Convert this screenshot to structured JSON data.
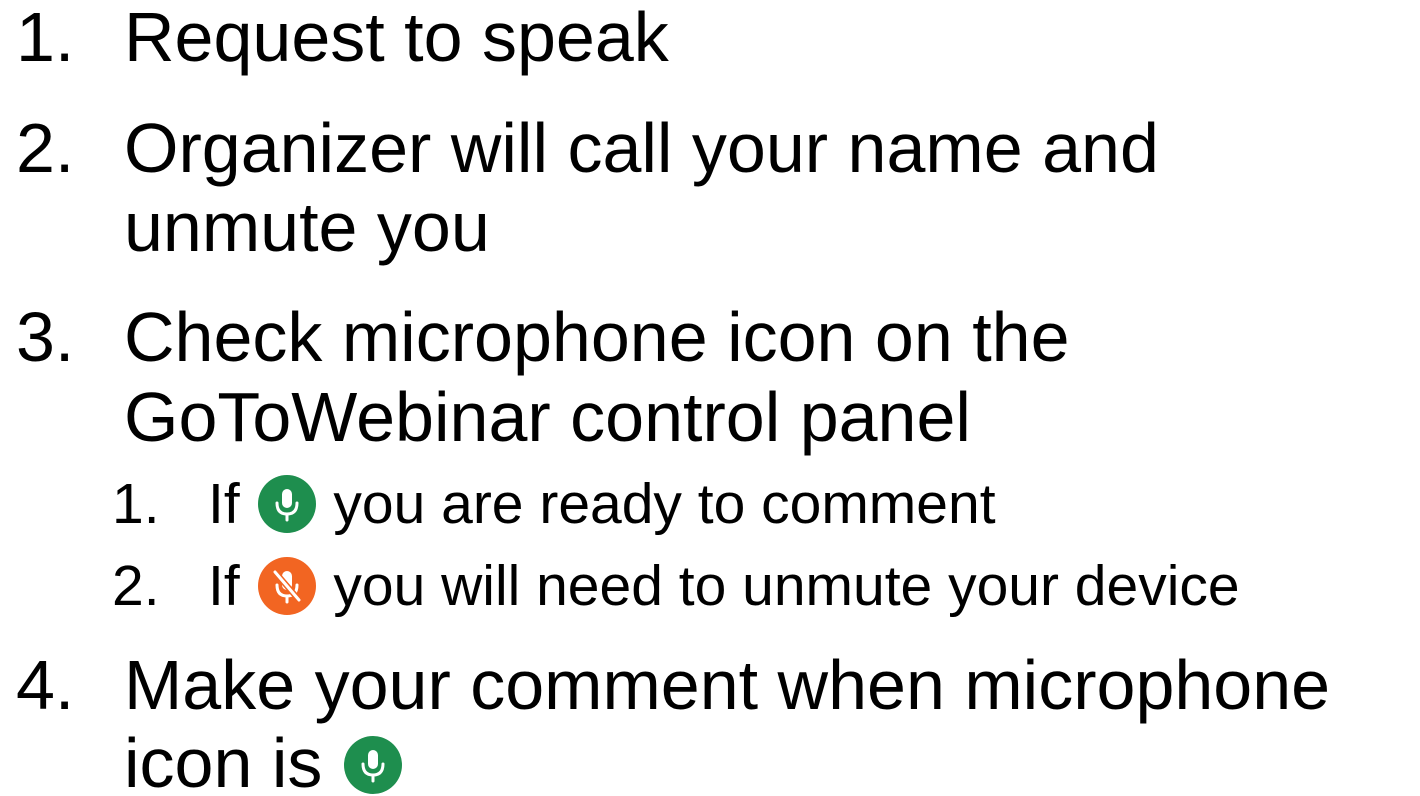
{
  "steps": [
    {
      "number": "1.",
      "lines": [
        "Request to speak"
      ]
    },
    {
      "number": "2.",
      "lines": [
        "Organizer will call your name and",
        "unmute you"
      ]
    },
    {
      "number": "3.",
      "lines": [
        "Check microphone icon on the",
        "GoToWebinar control panel"
      ],
      "substeps": [
        {
          "number": "1.",
          "prefix": "If",
          "icon": "microphone-unmuted-icon",
          "icon_color": "#1e8e4e",
          "suffix": "you are ready to comment"
        },
        {
          "number": "2.",
          "prefix": "If",
          "icon": "microphone-muted-icon",
          "icon_color": "#f26522",
          "suffix": "you will need to unmute your device"
        }
      ]
    },
    {
      "number": "4.",
      "lines": [
        "Make your comment when microphone",
        "icon is"
      ],
      "icon": "microphone-unmuted-icon",
      "icon_color": "#1e8e4e"
    }
  ]
}
